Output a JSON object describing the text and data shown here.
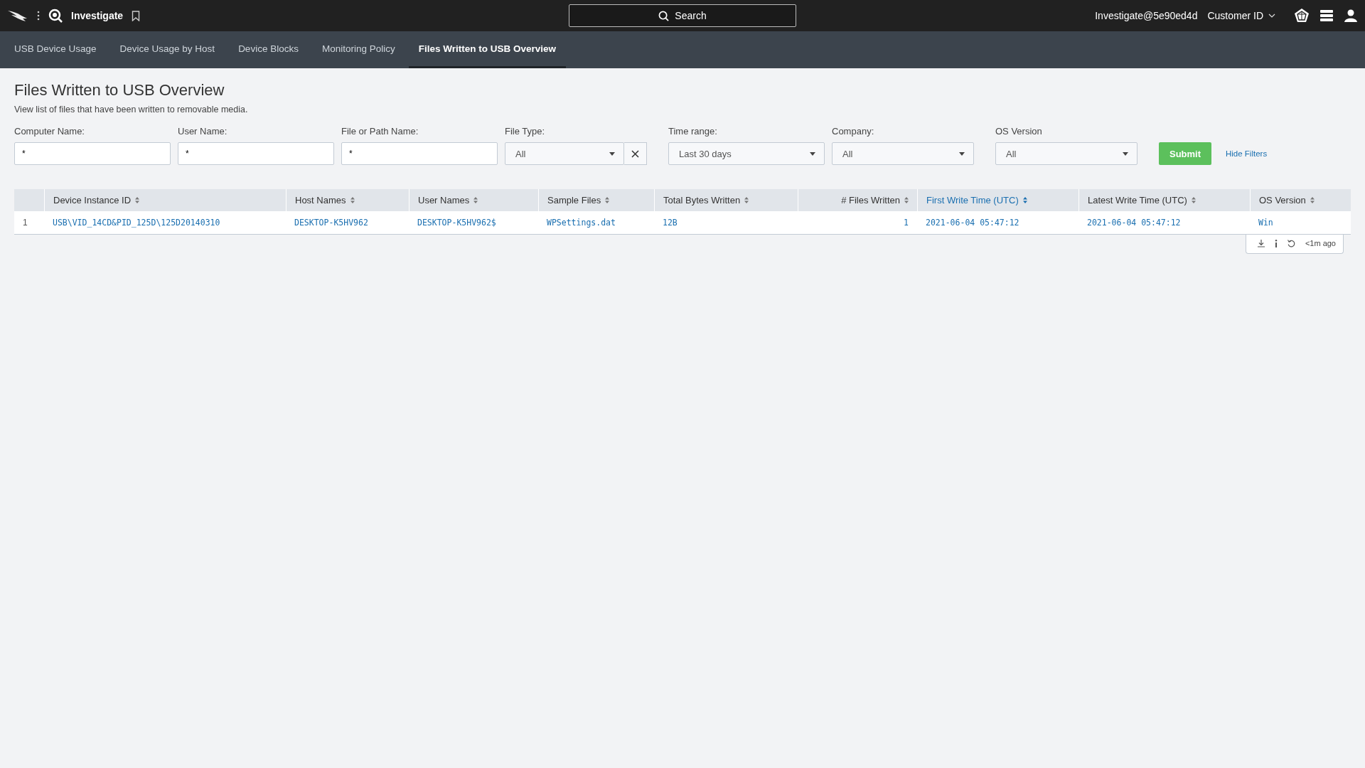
{
  "topbar": {
    "app_name": "Investigate",
    "search_label": "Search",
    "user": "Investigate@5e90ed4d",
    "customer_menu": "Customer ID"
  },
  "tabs": [
    {
      "label": "USB Device Usage",
      "selected": false
    },
    {
      "label": "Device Usage by Host",
      "selected": false
    },
    {
      "label": "Device Blocks",
      "selected": false
    },
    {
      "label": "Monitoring Policy",
      "selected": false
    },
    {
      "label": "Files Written to USB Overview",
      "selected": true
    }
  ],
  "page": {
    "title": "Files Written to USB Overview",
    "description": "View list of files that have been written to removable media."
  },
  "filters": [
    {
      "kind": "text",
      "label": "Computer Name:",
      "value": "*"
    },
    {
      "kind": "text",
      "label": "User Name:",
      "value": "*"
    },
    {
      "kind": "text",
      "label": "File or Path Name:",
      "value": "*"
    },
    {
      "kind": "select",
      "label": "File Type:",
      "value": "All",
      "clearable": true
    },
    {
      "kind": "select",
      "label": "Time range:",
      "value": "Last 30 days",
      "clearable": false
    },
    {
      "kind": "select",
      "label": "Company:",
      "value": "All",
      "clearable": false
    },
    {
      "kind": "select",
      "label": "OS Version",
      "value": "All",
      "clearable": false
    }
  ],
  "submit_label": "Submit",
  "hide_filters_label": "Hide Filters",
  "table": {
    "columns": [
      {
        "label": "Device Instance ID",
        "sorted": false
      },
      {
        "label": "Host Names",
        "sorted": false
      },
      {
        "label": "User Names",
        "sorted": false
      },
      {
        "label": "Sample Files",
        "sorted": false
      },
      {
        "label": "Total Bytes Written",
        "sorted": false
      },
      {
        "label": "# Files Written",
        "sorted": false
      },
      {
        "label": "First Write Time (UTC)",
        "sorted": true
      },
      {
        "label": "Latest Write Time (UTC)",
        "sorted": false
      },
      {
        "label": "OS Version",
        "sorted": false
      }
    ],
    "rows": [
      {
        "number": "1",
        "cells": [
          "USB\\VID_14CD&PID_125D\\125D20140310",
          "DESKTOP-K5HV962",
          "DESKTOP-K5HV962$",
          "WPSettings.dat",
          "12B",
          "1",
          "2021-06-04 05:47:12",
          "2021-06-04 05:47:12",
          "Win"
        ]
      }
    ]
  },
  "table_footer": {
    "updated": "<1m ago"
  }
}
